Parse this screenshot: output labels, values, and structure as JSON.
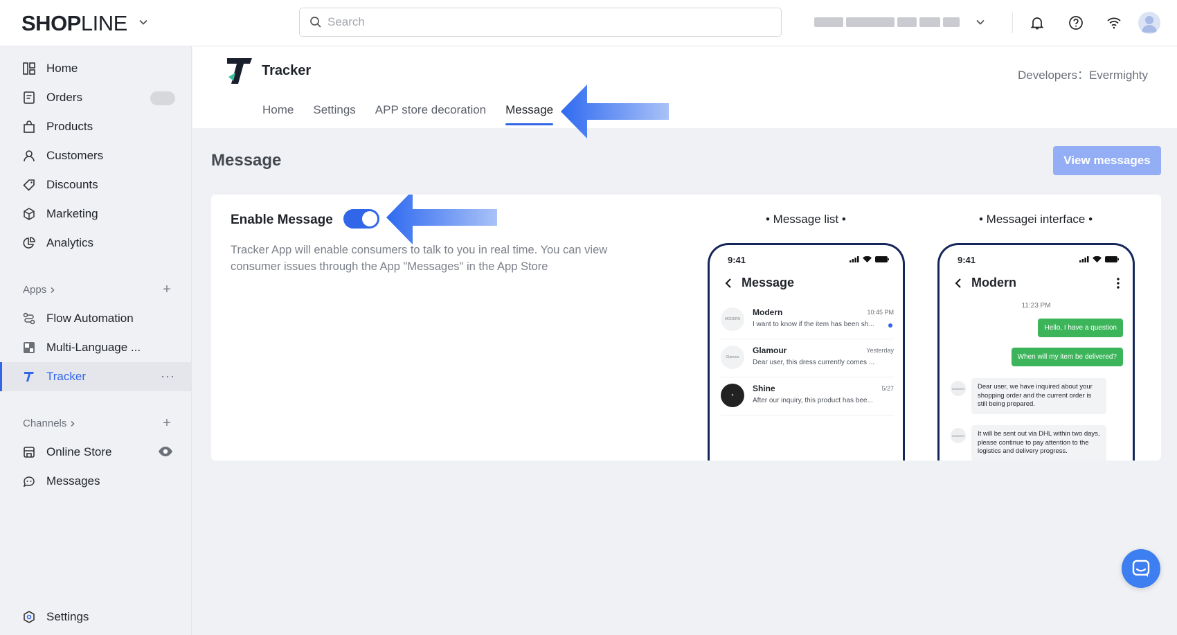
{
  "topbar": {
    "logo_bold": "SHOP",
    "logo_light": "LINE",
    "search_placeholder": "Search"
  },
  "sidebar": {
    "items": [
      {
        "label": "Home",
        "icon": "dashboard-icon"
      },
      {
        "label": "Orders",
        "icon": "orders-icon"
      },
      {
        "label": "Products",
        "icon": "bag-icon"
      },
      {
        "label": "Customers",
        "icon": "person-icon"
      },
      {
        "label": "Discounts",
        "icon": "tag-icon"
      },
      {
        "label": "Marketing",
        "icon": "cube-icon"
      },
      {
        "label": "Analytics",
        "icon": "pie-icon"
      }
    ],
    "apps_label": "Apps",
    "apps": [
      {
        "label": "Flow Automation",
        "icon": "flow-icon"
      },
      {
        "label": "Multi-Language ...",
        "icon": "language-icon"
      },
      {
        "label": "Tracker",
        "icon": "tracker-icon"
      }
    ],
    "channels_label": "Channels",
    "channels": [
      {
        "label": "Online Store",
        "icon": "store-icon"
      },
      {
        "label": "Messages",
        "icon": "messages-icon"
      }
    ],
    "settings_label": "Settings"
  },
  "app": {
    "title": "Tracker",
    "developer": "Developers：Evermighty",
    "tabs": [
      "Home",
      "Settings",
      "APP store decoration",
      "Message"
    ],
    "active_tab": "Message"
  },
  "main": {
    "page_title": "Message",
    "view_button": "View messages",
    "enable_label": "Enable Message",
    "enabled": true,
    "description": "Tracker App will enable consumers to talk to you in real time. You can view consumer issues through the App \"Messages\" in the App Store",
    "preview_list_label": "• Message list •",
    "preview_interface_label": "• Messagei interface •"
  },
  "phone_list": {
    "time": "9:41",
    "title": "Message",
    "messages": [
      {
        "name": "Modern",
        "time": "10:45 PM",
        "text": "I want to know if the item has been sh...",
        "avatar": "MODERN"
      },
      {
        "name": "Glamour",
        "time": "Yesterday",
        "text": "Dear user, this dress currently comes ...",
        "avatar": "Glamour"
      },
      {
        "name": "Shine",
        "time": "5/27",
        "text": "After our inquiry, this product has bee...",
        "avatar": "✦"
      }
    ]
  },
  "phone_chat": {
    "time": "9:41",
    "title": "Modern",
    "chat_time": "11:23 PM",
    "sent": [
      "Hello, I have a question",
      "When will my item be delivered?"
    ],
    "received": [
      "Dear user, we have inquired about your shopping order and the current order is still being prepared.",
      "It will be sent out via DHL within two days, please continue to pay attention to the logistics and delivery progress."
    ],
    "avatar": "MODERN"
  },
  "colors": {
    "accent": "#3266e8",
    "button_disabled": "#93aef5",
    "chat_green": "#3cb55a",
    "phone_frame": "#15275a"
  }
}
